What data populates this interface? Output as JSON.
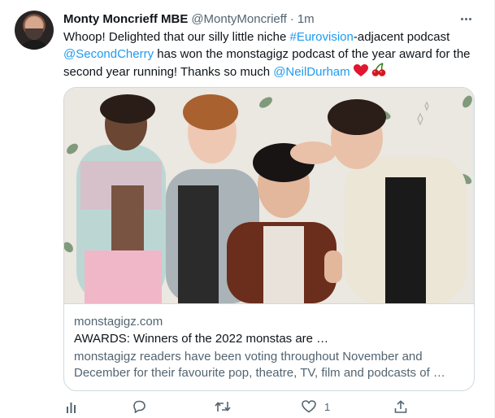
{
  "tweet": {
    "author_name": "Monty Moncrieff MBE",
    "author_handle": "@MontyMoncrieff",
    "separator": "·",
    "timestamp": "1m",
    "text_parts": {
      "p1": "Whoop! Delighted that our silly little niche ",
      "hashtag": "#Eurovision",
      "p2": "-adjacent podcast ",
      "mention1": "@SecondCherry",
      "p3": " has won the monstagigz podcast of the year award for the second year running! Thanks so much ",
      "mention2": "@NeilDurham"
    },
    "emojis": [
      "red-heart",
      "cherries"
    ]
  },
  "card": {
    "domain": "monstagigz.com",
    "title": "AWARDS: Winners of the 2022 monstas are …",
    "description": "monstagigz readers have been voting throughout November and December for their favourite pop, theatre, TV, film and podcasts of …"
  },
  "actions": {
    "reply_count": "",
    "retweet_count": "",
    "like_count": "1",
    "icons": [
      "analytics-icon",
      "reply-icon",
      "retweet-icon",
      "like-icon",
      "share-icon"
    ]
  },
  "colors": {
    "link": "#1d9bf0",
    "secondary_text": "#536471",
    "border": "#cfd9de"
  }
}
